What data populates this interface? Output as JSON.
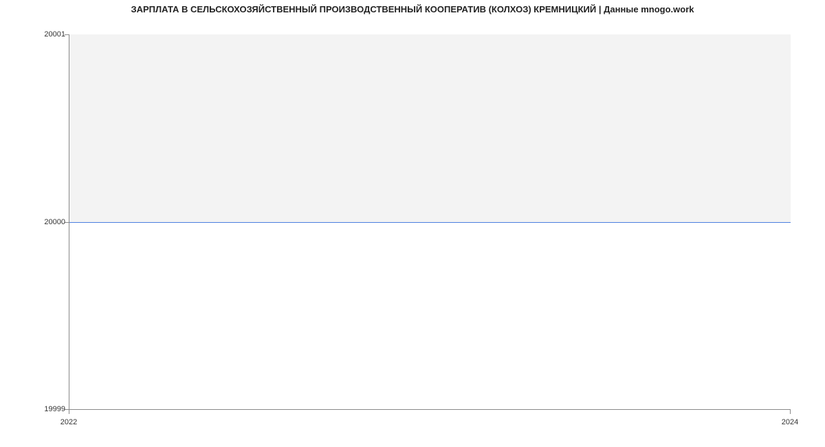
{
  "chart_data": {
    "type": "area",
    "title": "ЗАРПЛАТА В СЕЛЬСКОХОЗЯЙСТВЕННЫЙ ПРОИЗВОДСТВЕННЫЙ КООПЕРАТИВ (КОЛХОЗ) КРЕМНИЦКИЙ | Данные mnogo.work",
    "x": [
      2022,
      2024
    ],
    "series": [
      {
        "name": "salary",
        "values": [
          20000,
          20000
        ]
      }
    ],
    "xlabel": "",
    "ylabel": "",
    "ylim": [
      19999,
      20001
    ],
    "xlim": [
      2022,
      2024
    ],
    "x_ticks": [
      "2022",
      "2024"
    ],
    "y_ticks": [
      "19999",
      "20000",
      "20001"
    ]
  }
}
